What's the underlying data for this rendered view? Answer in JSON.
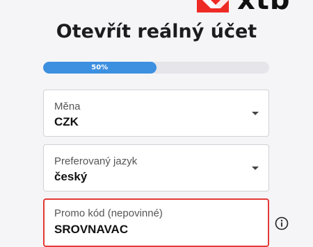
{
  "brand": {
    "name": "xtb",
    "color": "#ee2a24"
  },
  "page": {
    "title": "Otevřít reálný účet"
  },
  "progress": {
    "value": 50,
    "label": "50%",
    "color": "#3d8fe0"
  },
  "form": {
    "currency": {
      "label": "Měna",
      "value": "CZK",
      "icon": "chevron-down-icon"
    },
    "language": {
      "label": "Preferovaný jazyk",
      "value": "český",
      "icon": "chevron-down-icon"
    },
    "promo": {
      "label": "Promo kód (nepovinné)",
      "value": "SROVNAVAC",
      "border_color": "#e53935",
      "info_icon": "info-icon"
    }
  }
}
